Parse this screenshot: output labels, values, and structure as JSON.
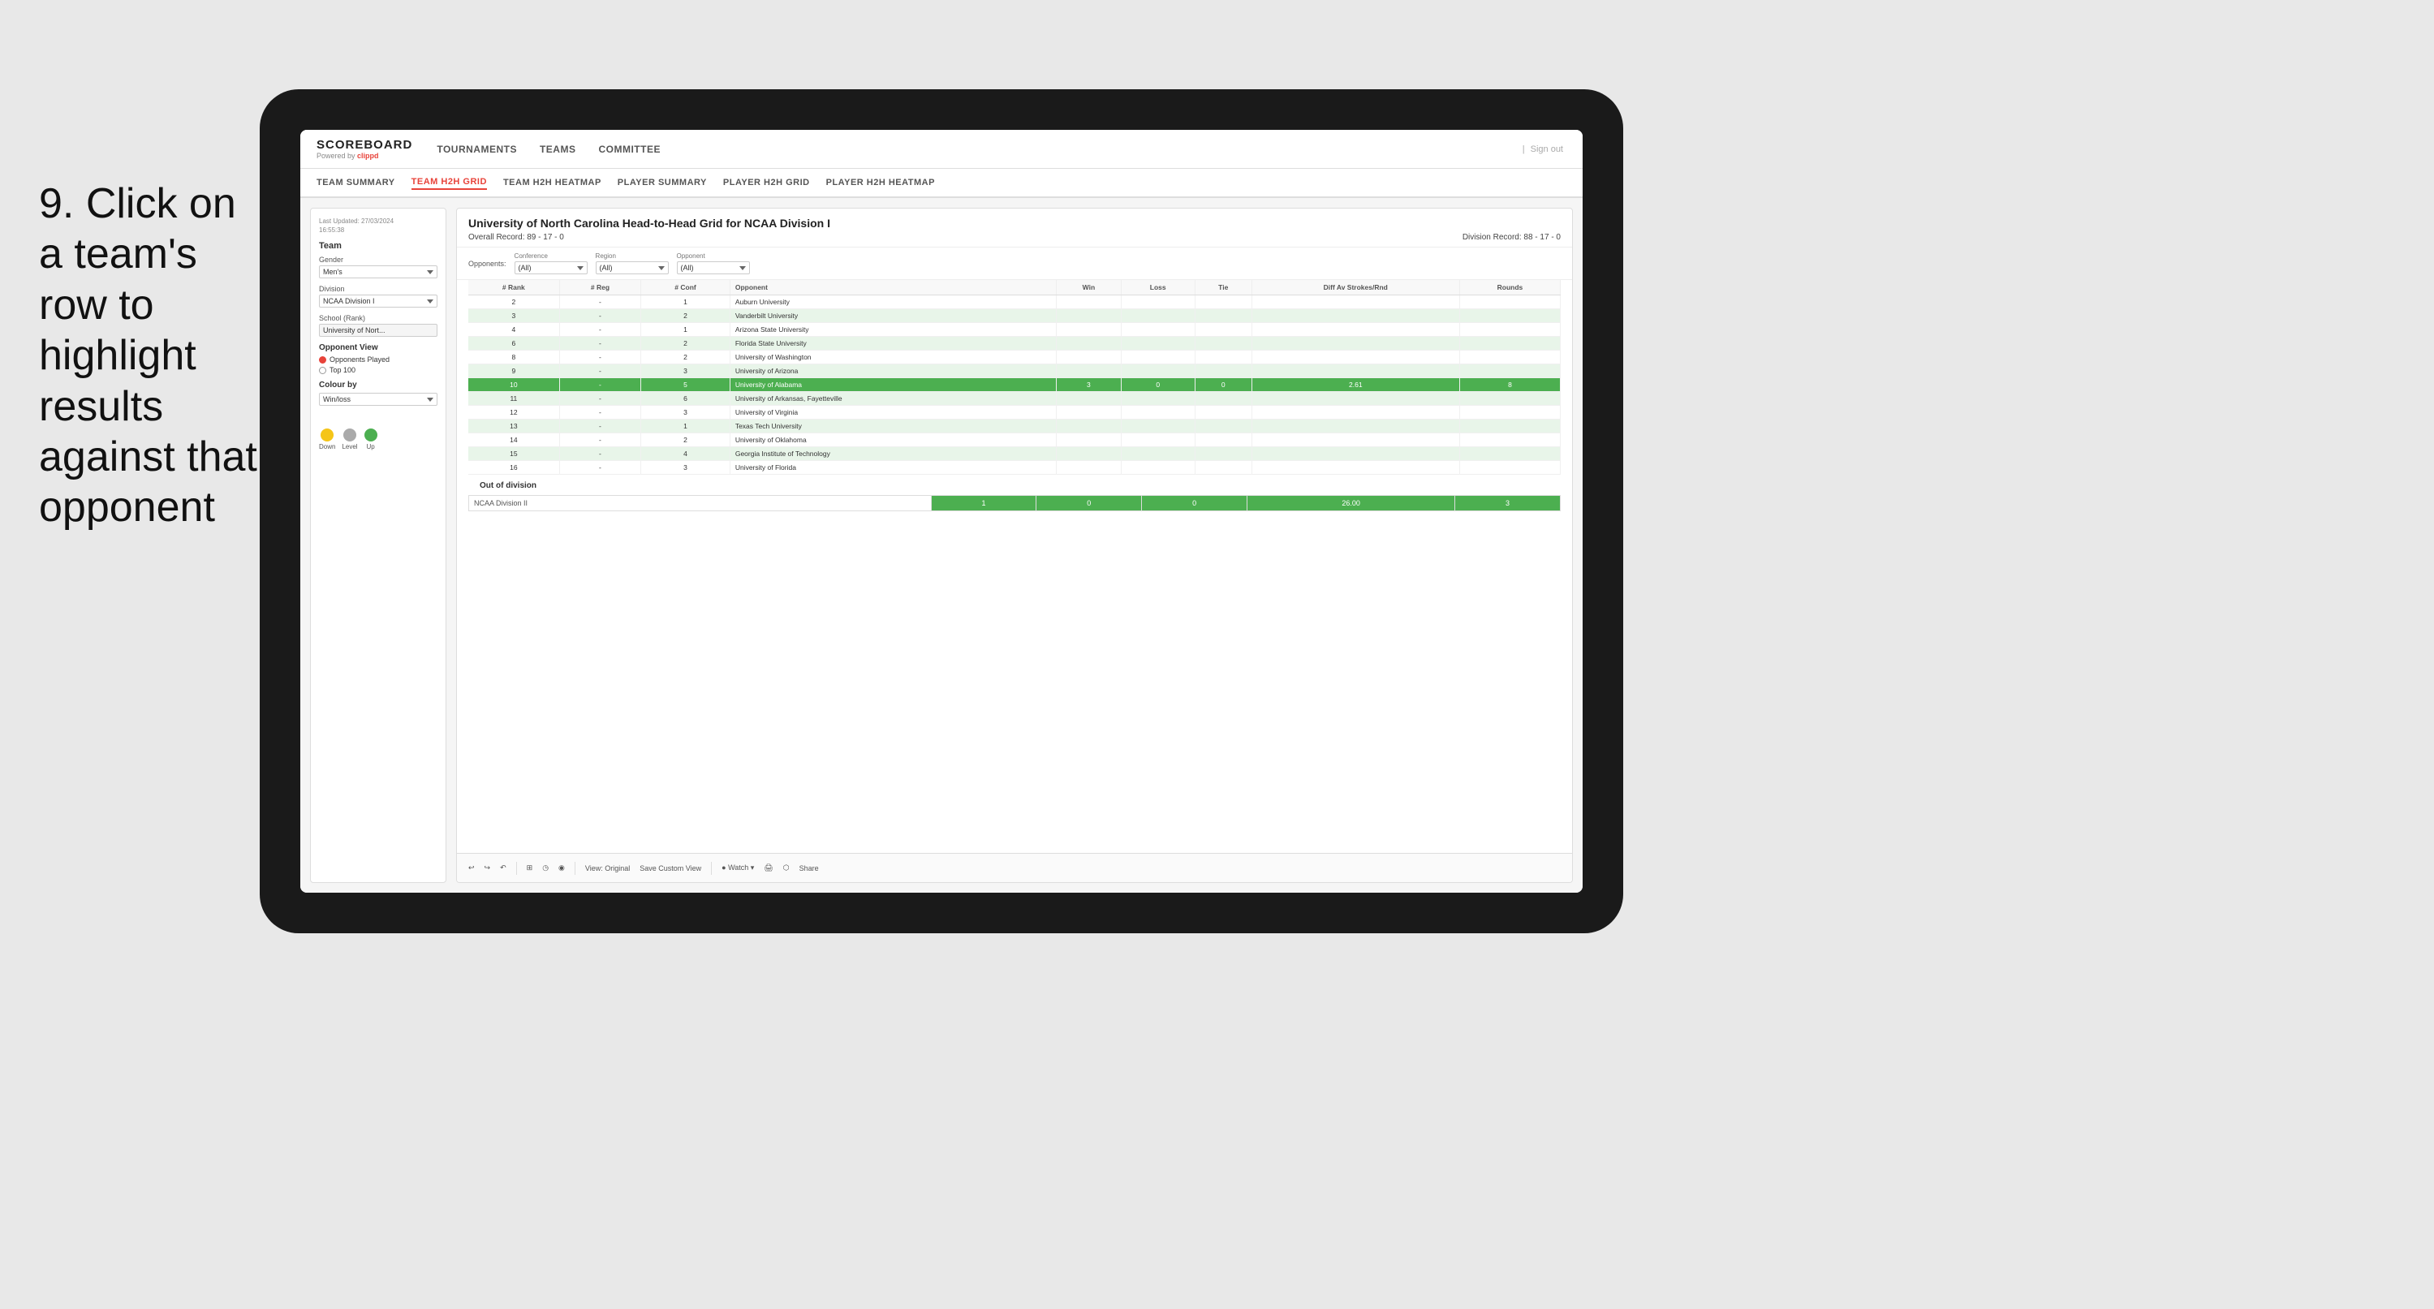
{
  "instruction": {
    "text": "9. Click on a team's row to highlight results against that opponent"
  },
  "nav": {
    "logo": "SCOREBOARD",
    "logo_sub": "Powered by",
    "logo_brand": "clippd",
    "links": [
      "TOURNAMENTS",
      "TEAMS",
      "COMMITTEE"
    ],
    "sign_out": "Sign out"
  },
  "sub_nav": {
    "links": [
      "TEAM SUMMARY",
      "TEAM H2H GRID",
      "TEAM H2H HEATMAP",
      "PLAYER SUMMARY",
      "PLAYER H2H GRID",
      "PLAYER H2H HEATMAP"
    ],
    "active": "TEAM H2H GRID"
  },
  "sidebar": {
    "last_updated_label": "Last Updated: 27/03/2024",
    "last_updated_time": "16:55:38",
    "team_label": "Team",
    "gender_label": "Gender",
    "gender_value": "Men's",
    "division_label": "Division",
    "division_value": "NCAA Division I",
    "school_label": "School (Rank)",
    "school_value": "University of Nort...",
    "opponent_view_label": "Opponent View",
    "opponent_options": [
      "Opponents Played",
      "Top 100"
    ],
    "opponent_selected": "Opponents Played",
    "colour_by_label": "Colour by",
    "colour_by_value": "Win/loss",
    "legend": {
      "down_label": "Down",
      "down_color": "#f5c518",
      "level_label": "Level",
      "level_color": "#aaaaaa",
      "up_label": "Up",
      "up_color": "#4caf50"
    }
  },
  "grid": {
    "title": "University of North Carolina Head-to-Head Grid for NCAA Division I",
    "overall_record_label": "Overall Record:",
    "overall_record": "89 - 17 - 0",
    "division_record_label": "Division Record:",
    "division_record": "88 - 17 - 0",
    "filters": {
      "opponents_label": "Opponents:",
      "conference_label": "Conference",
      "conference_value": "(All)",
      "region_label": "Region",
      "region_value": "(All)",
      "opponent_label": "Opponent",
      "opponent_value": "(All)"
    },
    "columns": [
      "# Rank",
      "# Reg",
      "# Conf",
      "Opponent",
      "Win",
      "Loss",
      "Tie",
      "Diff Av Strokes/Rnd",
      "Rounds"
    ],
    "rows": [
      {
        "rank": "2",
        "reg": "-",
        "conf": "1",
        "opponent": "Auburn University",
        "win": "",
        "loss": "",
        "tie": "",
        "diff": "",
        "rounds": "",
        "style": "normal"
      },
      {
        "rank": "3",
        "reg": "-",
        "conf": "2",
        "opponent": "Vanderbilt University",
        "win": "",
        "loss": "",
        "tie": "",
        "diff": "",
        "rounds": "",
        "style": "light-green"
      },
      {
        "rank": "4",
        "reg": "-",
        "conf": "1",
        "opponent": "Arizona State University",
        "win": "",
        "loss": "",
        "tie": "",
        "diff": "",
        "rounds": "",
        "style": "normal"
      },
      {
        "rank": "6",
        "reg": "-",
        "conf": "2",
        "opponent": "Florida State University",
        "win": "",
        "loss": "",
        "tie": "",
        "diff": "",
        "rounds": "",
        "style": "light-green"
      },
      {
        "rank": "8",
        "reg": "-",
        "conf": "2",
        "opponent": "University of Washington",
        "win": "",
        "loss": "",
        "tie": "",
        "diff": "",
        "rounds": "",
        "style": "normal"
      },
      {
        "rank": "9",
        "reg": "-",
        "conf": "3",
        "opponent": "University of Arizona",
        "win": "",
        "loss": "",
        "tie": "",
        "diff": "",
        "rounds": "",
        "style": "light-green"
      },
      {
        "rank": "10",
        "reg": "-",
        "conf": "5",
        "opponent": "University of Alabama",
        "win": "3",
        "loss": "0",
        "tie": "0",
        "diff": "2.61",
        "rounds": "8",
        "style": "highlighted"
      },
      {
        "rank": "11",
        "reg": "-",
        "conf": "6",
        "opponent": "University of Arkansas, Fayetteville",
        "win": "",
        "loss": "",
        "tie": "",
        "diff": "",
        "rounds": "",
        "style": "light-green"
      },
      {
        "rank": "12",
        "reg": "-",
        "conf": "3",
        "opponent": "University of Virginia",
        "win": "",
        "loss": "",
        "tie": "",
        "diff": "",
        "rounds": "",
        "style": "normal"
      },
      {
        "rank": "13",
        "reg": "-",
        "conf": "1",
        "opponent": "Texas Tech University",
        "win": "",
        "loss": "",
        "tie": "",
        "diff": "",
        "rounds": "",
        "style": "light-green"
      },
      {
        "rank": "14",
        "reg": "-",
        "conf": "2",
        "opponent": "University of Oklahoma",
        "win": "",
        "loss": "",
        "tie": "",
        "diff": "",
        "rounds": "",
        "style": "normal"
      },
      {
        "rank": "15",
        "reg": "-",
        "conf": "4",
        "opponent": "Georgia Institute of Technology",
        "win": "",
        "loss": "",
        "tie": "",
        "diff": "",
        "rounds": "",
        "style": "light-green"
      },
      {
        "rank": "16",
        "reg": "-",
        "conf": "3",
        "opponent": "University of Florida",
        "win": "",
        "loss": "",
        "tie": "",
        "diff": "",
        "rounds": "",
        "style": "normal"
      }
    ],
    "out_of_division_label": "Out of division",
    "out_of_division_row": {
      "label": "NCAA Division II",
      "win": "1",
      "loss": "0",
      "tie": "0",
      "diff": "26.00",
      "rounds": "3"
    }
  },
  "toolbar": {
    "buttons": [
      "↩",
      "↪",
      "↶",
      "⊞",
      "◷",
      "◉",
      "View: Original",
      "Save Custom View",
      "Watch ▾",
      "🖨",
      "⬡",
      "Share"
    ]
  }
}
